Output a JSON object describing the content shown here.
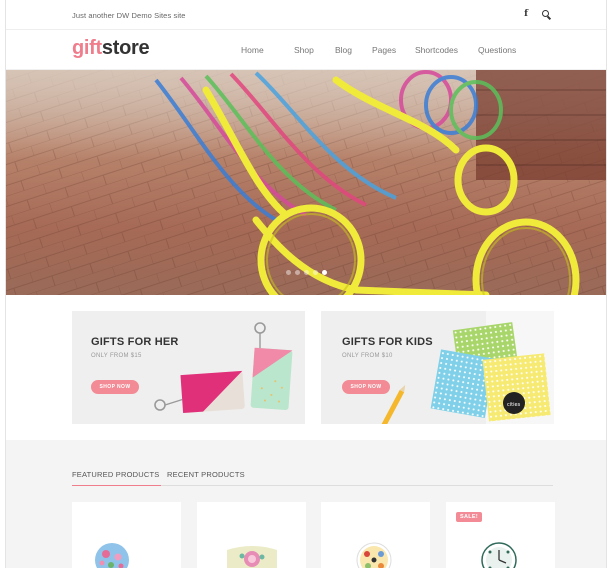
{
  "topbar": {
    "tagline": "Just another DW Demo Sites site",
    "icons": [
      "facebook-icon",
      "search-icon"
    ]
  },
  "logo": {
    "part1": "gift",
    "part2": "store",
    "colors": {
      "gift": "#f07d8c",
      "store": "#333333"
    }
  },
  "nav": [
    {
      "label": "Home"
    },
    {
      "label": "Shop"
    },
    {
      "label": "Blog"
    },
    {
      "label": "Pages"
    },
    {
      "label": "Shortcodes"
    },
    {
      "label": "Questions"
    }
  ],
  "hero": {
    "slide_count": 5,
    "active_slide": 5
  },
  "banners": [
    {
      "title": "GIFTS FOR HER",
      "subtitle": "ONLY FROM $15",
      "button": "SHOP NOW"
    },
    {
      "title": "GIFTS FOR KIDS",
      "subtitle": "ONLY FROM $10",
      "button": "SHOP NOW"
    }
  ],
  "products": {
    "tabs": [
      {
        "label": "FEATURED PRODUCTS",
        "active": true
      },
      {
        "label": "RECENT PRODUCTS",
        "active": false
      }
    ],
    "cards": [
      {
        "badge": ""
      },
      {
        "badge": ""
      },
      {
        "badge": ""
      },
      {
        "badge": "SALE!"
      }
    ]
  },
  "colors": {
    "accent": "#f07d8c",
    "button": "#f28b95"
  }
}
